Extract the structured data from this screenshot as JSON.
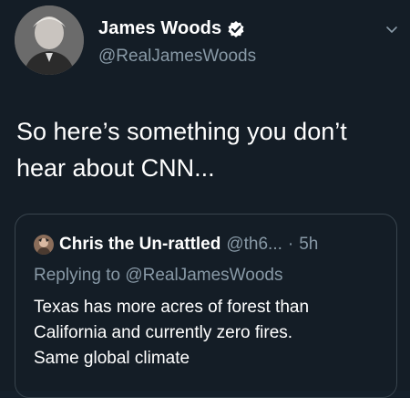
{
  "tweet": {
    "author": {
      "display_name": "James Woods",
      "handle": "@RealJamesWoods",
      "verified": true,
      "avatar_icon": "avatar-photo"
    },
    "text_lines": [
      "So here’s something you don’t",
      "hear about CNN..."
    ],
    "menu_icon": "chevron-down-icon"
  },
  "quoted_tweet": {
    "author": {
      "display_name": "Chris the Un-rattled",
      "handle": "@th6...",
      "avatar_icon": "avatar-photo"
    },
    "separator": "·",
    "time": "5h",
    "replying_to": "Replying to @RealJamesWoods",
    "text_lines": [
      "Texas has more acres of forest than",
      "California and currently zero fires.",
      "Same global climate"
    ]
  },
  "colors": {
    "background": "#141d26",
    "secondary_text": "#8899a6",
    "border": "#38444d",
    "verified_badge": "#ffffff"
  }
}
